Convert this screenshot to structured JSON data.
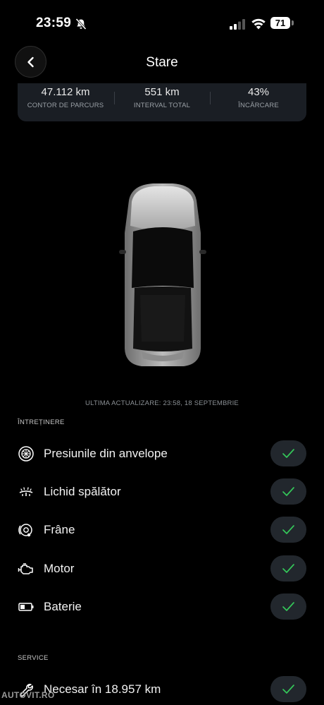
{
  "status_bar": {
    "time": "23:59",
    "battery": "71"
  },
  "header": {
    "title": "Stare"
  },
  "stats": [
    {
      "value": "47.112 km",
      "label": "CONTOR DE PARCURS"
    },
    {
      "value": "551 km",
      "label": "INTERVAL TOTAL"
    },
    {
      "value": "43%",
      "label": "ÎNCĂRCARE"
    }
  ],
  "last_update": "ULTIMA ACTUALIZARE: 23:58, 18 SEPTEMBRIE",
  "maintenance": {
    "heading": "ÎNTREȚINERE",
    "items": [
      {
        "label": "Presiunile din anvelope",
        "icon": "tyre-icon"
      },
      {
        "label": "Lichid spălător",
        "icon": "washer-fluid-icon"
      },
      {
        "label": "Frâne",
        "icon": "brake-icon"
      },
      {
        "label": "Motor",
        "icon": "engine-icon"
      },
      {
        "label": "Baterie",
        "icon": "battery-icon"
      }
    ]
  },
  "service": {
    "heading": "SERVICE",
    "items": [
      {
        "label": "Necesar în 18.957 km",
        "icon": "wrench-icon"
      }
    ]
  },
  "watermark": "AUTOVIT.RO",
  "colors": {
    "background": "#000000",
    "card": "#1a1e24",
    "check": "#34c759",
    "check_bg": "#22272d"
  }
}
